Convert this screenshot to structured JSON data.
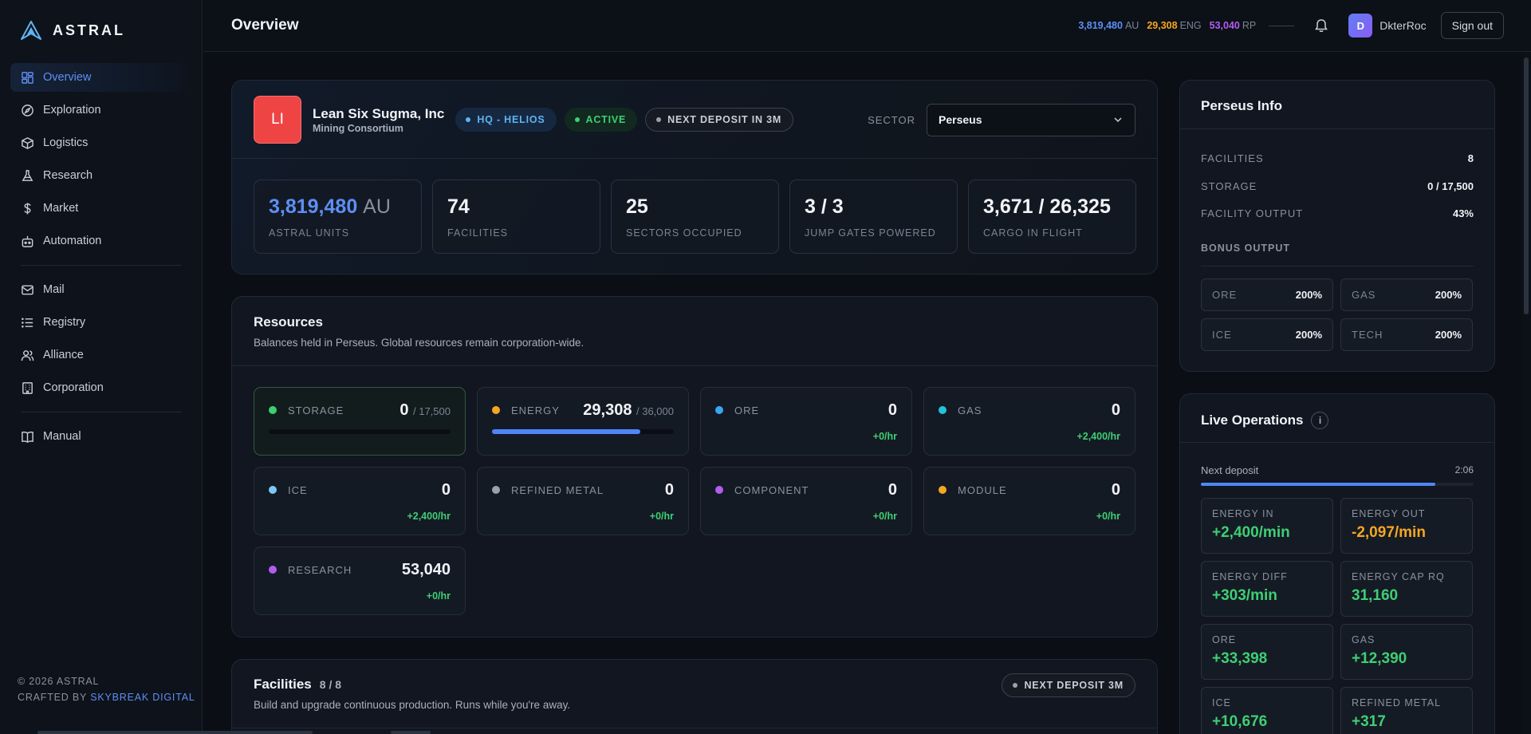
{
  "brand": {
    "name": "ASTRAL"
  },
  "nav": {
    "primary": [
      {
        "label": "Overview",
        "icon": "dashboard-icon",
        "active": true
      },
      {
        "label": "Exploration",
        "icon": "compass-icon"
      },
      {
        "label": "Logistics",
        "icon": "package-icon"
      },
      {
        "label": "Research",
        "icon": "flask-icon"
      },
      {
        "label": "Market",
        "icon": "dollar-icon"
      },
      {
        "label": "Automation",
        "icon": "bot-icon"
      }
    ],
    "secondary": [
      {
        "label": "Mail",
        "icon": "mail-icon"
      },
      {
        "label": "Registry",
        "icon": "list-icon"
      },
      {
        "label": "Alliance",
        "icon": "users-icon"
      },
      {
        "label": "Corporation",
        "icon": "building-icon"
      }
    ],
    "tertiary": [
      {
        "label": "Manual",
        "icon": "book-icon"
      }
    ]
  },
  "footer": {
    "copyright": "© 2026 ASTRAL",
    "crafted_prefix": "CRAFTED BY",
    "crafted_link": "SKYBREAK DIGITAL"
  },
  "topbar": {
    "title": "Overview",
    "au_value": "3,819,480",
    "au_unit": "AU",
    "eng_value": "29,308",
    "eng_unit": "ENG",
    "rp_value": "53,040",
    "rp_unit": "RP",
    "avatar_initial": "D",
    "username": "DkterRoc",
    "signout_label": "Sign out"
  },
  "corp": {
    "logo_initials": "LI",
    "name": "Lean Six Sugma, Inc",
    "type": "Mining Consortium",
    "pill_hq": "HQ - HELIOS",
    "pill_active": "ACTIVE",
    "pill_deposit": "NEXT DEPOSIT IN 3M",
    "sector_label": "SECTOR",
    "sector_value": "Perseus",
    "stats": {
      "au_value": "3,819,480",
      "au_unit": "AU",
      "au_label": "ASTRAL UNITS",
      "fac_value": "74",
      "fac_label": "FACILITIES",
      "sec_value": "25",
      "sec_label": "SECTORS OCCUPIED",
      "jump_value": "3 / 3",
      "jump_label": "JUMP GATES POWERED",
      "cargo_value": "3,671 / 26,325",
      "cargo_label": "CARGO IN FLIGHT"
    }
  },
  "resources": {
    "title": "Resources",
    "subtitle": "Balances held in Perseus. Global resources remain corporation-wide.",
    "cards": [
      {
        "label": "STORAGE",
        "value": "0",
        "max": "/ 17,500",
        "color": "#3ecf74",
        "progress": 0,
        "highlight": true
      },
      {
        "label": "ENERGY",
        "value": "29,308",
        "max": "/ 36,000",
        "color": "#f5a623",
        "progress": 0.814
      },
      {
        "label": "ORE",
        "value": "0",
        "rate": "+0/hr",
        "color": "#38a7f2"
      },
      {
        "label": "GAS",
        "value": "0",
        "rate": "+2,400/hr",
        "color": "#22c3d9"
      },
      {
        "label": "ICE",
        "value": "0",
        "rate": "+2,400/hr",
        "color": "#7cc8f5"
      },
      {
        "label": "REFINED METAL",
        "value": "0",
        "rate": "+0/hr",
        "color": "#9aa1ad"
      },
      {
        "label": "COMPONENT",
        "value": "0",
        "rate": "+0/hr",
        "color": "#b35cf0"
      },
      {
        "label": "MODULE",
        "value": "0",
        "rate": "+0/hr",
        "color": "#f5a623"
      },
      {
        "label": "RESEARCH",
        "value": "53,040",
        "rate": "+0/hr",
        "color": "#b35cf0"
      }
    ]
  },
  "facilities": {
    "title": "Facilities",
    "count": "8 / 8",
    "subtitle": "Build and upgrade continuous production. Runs while you're away.",
    "pill": "NEXT DEPOSIT 3M"
  },
  "info": {
    "title": "Perseus Info",
    "rows": [
      {
        "k": "FACILITIES",
        "v": "8"
      },
      {
        "k": "STORAGE",
        "v": "0 / 17,500"
      },
      {
        "k": "FACILITY OUTPUT",
        "v": "43%"
      }
    ],
    "bonus_label": "BONUS OUTPUT",
    "bonus": [
      {
        "k": "ORE",
        "v": "200%"
      },
      {
        "k": "GAS",
        "v": "200%"
      },
      {
        "k": "ICE",
        "v": "200%"
      },
      {
        "k": "TECH",
        "v": "200%"
      }
    ]
  },
  "live": {
    "title": "Live Operations",
    "info_glyph": "i",
    "next_deposit_label": "Next deposit",
    "next_deposit_time": "2:06",
    "next_deposit_progress": 0.86,
    "ops": [
      {
        "k": "ENERGY IN",
        "v": "+2,400/min",
        "color": "#3ecf74"
      },
      {
        "k": "ENERGY OUT",
        "v": "-2,097/min",
        "color": "#f5a623"
      },
      {
        "k": "ENERGY DIFF",
        "v": "+303/min",
        "color": "#3ecf74"
      },
      {
        "k": "ENERGY CAP RQ",
        "v": "31,160",
        "color": "#3ecf74"
      },
      {
        "k": "ORE",
        "v": "+33,398",
        "color": "#3ecf74"
      },
      {
        "k": "GAS",
        "v": "+12,390",
        "color": "#3ecf74"
      },
      {
        "k": "ICE",
        "v": "+10,676",
        "color": "#3ecf74"
      },
      {
        "k": "REFINED METAL",
        "v": "+317",
        "color": "#3ecf74"
      }
    ]
  }
}
